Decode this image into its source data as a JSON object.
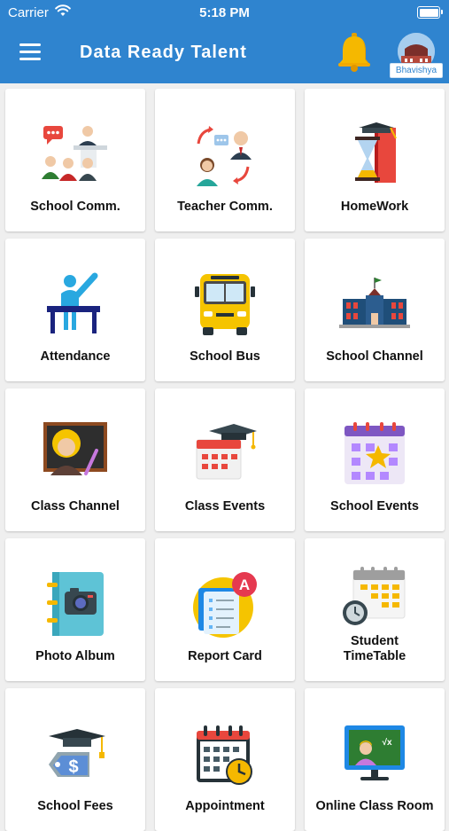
{
  "status_bar": {
    "carrier": "Carrier",
    "time": "5:18 PM"
  },
  "header": {
    "title": "Data Ready Talent",
    "profile_name": "Bhavishya"
  },
  "colors": {
    "header": "#2f84cf",
    "background": "#efefef",
    "bell": "#f5b800"
  },
  "tiles": [
    {
      "label": "School Comm.",
      "icon": "school-communication-icon"
    },
    {
      "label": "Teacher Comm.",
      "icon": "teacher-communication-icon"
    },
    {
      "label": "HomeWork",
      "icon": "homework-icon"
    },
    {
      "label": "Attendance",
      "icon": "attendance-icon"
    },
    {
      "label": "School Bus",
      "icon": "school-bus-icon"
    },
    {
      "label": "School Channel",
      "icon": "school-channel-icon"
    },
    {
      "label": "Class Channel",
      "icon": "class-channel-icon"
    },
    {
      "label": "Class Events",
      "icon": "class-events-icon"
    },
    {
      "label": "School Events",
      "icon": "school-events-icon"
    },
    {
      "label": "Photo Album",
      "icon": "photo-album-icon"
    },
    {
      "label": "Report Card",
      "icon": "report-card-icon"
    },
    {
      "label": "Student\nTimeTable",
      "icon": "student-timetable-icon"
    },
    {
      "label": "School Fees",
      "icon": "school-fees-icon"
    },
    {
      "label": "Appointment",
      "icon": "appointment-icon"
    },
    {
      "label": "Online Class Room",
      "icon": "online-class-icon"
    }
  ]
}
